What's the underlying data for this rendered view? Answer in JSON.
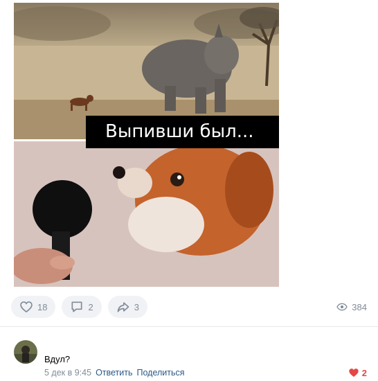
{
  "post": {
    "caption": "Выпивши был...",
    "actions": {
      "likes": "18",
      "comments": "2",
      "shares": "3"
    },
    "views": "384"
  },
  "comment": {
    "text": "Вдул?",
    "date": "5 дек в 9:45",
    "reply_label": "Ответить",
    "share_label": "Поделиться",
    "likes": "2"
  },
  "icons": {
    "like": "heart-outline-icon",
    "comment": "speech-bubble-icon",
    "share": "share-arrow-icon",
    "views": "eye-icon",
    "comment_like": "heart-filled-icon"
  },
  "colors": {
    "muted": "#818c99",
    "link": "#2a5885",
    "like_active": "#e64646",
    "button_bg": "#f0f2f5"
  }
}
